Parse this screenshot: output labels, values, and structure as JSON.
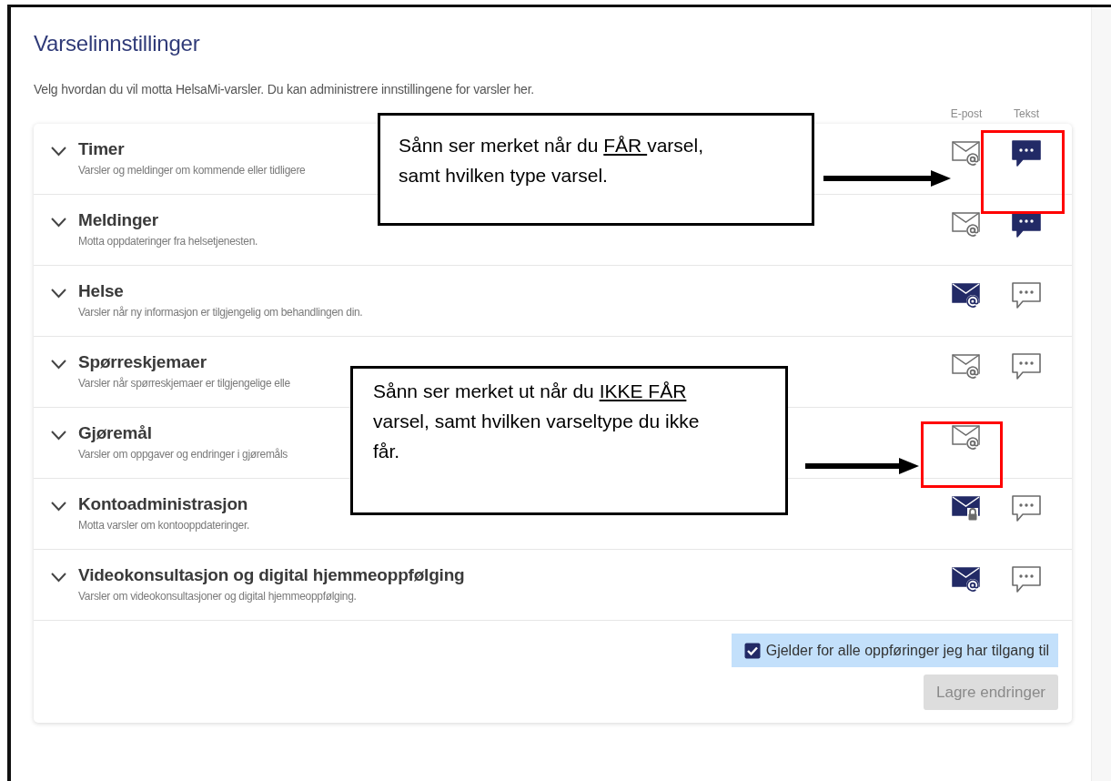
{
  "title": "Varselinnstillinger",
  "description": "Velg hvordan du vil motta HelsaMi-varsler. Du kan administrere innstillingene for varsler her.",
  "columns": [
    "E-post",
    "Tekst"
  ],
  "categories": [
    {
      "name": "Timer",
      "description": "Varsler og meldinger om kommende eller tidligere",
      "email": {
        "on": false,
        "kind": "at"
      },
      "text": {
        "on": true
      }
    },
    {
      "name": "Meldinger",
      "description": "Motta oppdateringer fra helsetjenesten.",
      "email": {
        "on": false,
        "kind": "at"
      },
      "text": {
        "on": true
      }
    },
    {
      "name": "Helse",
      "description": "Varsler når ny informasjon er tilgjengelig om behandlingen din.",
      "email": {
        "on": true,
        "kind": "at"
      },
      "text": {
        "on": false
      }
    },
    {
      "name": "Spørreskjemaer",
      "description": "Varsler når spørreskjemaer er tilgjengelige elle",
      "email": {
        "on": false,
        "kind": "at"
      },
      "text": {
        "on": false
      }
    },
    {
      "name": "Gjøremål",
      "description": "Varsler om oppgaver og endringer i gjøremåls",
      "email": {
        "on": false,
        "kind": "at"
      }
    },
    {
      "name": "Kontoadministrasjon",
      "description": "Motta varsler om kontooppdateringer.",
      "email": {
        "on": true,
        "kind": "lock"
      },
      "text": {
        "on": false
      }
    },
    {
      "name": "Videokonsultasjon og digital hjemmeoppfølging",
      "description": "Varsler om videokonsultasjoner og digital hjemmeoppfølging.",
      "email": {
        "on": true,
        "kind": "at"
      },
      "text": {
        "on": false
      }
    }
  ],
  "apply_all": {
    "label": "Gjelder for alle oppføringer jeg har tilgang til",
    "checked": true
  },
  "save_button": {
    "label": "Lagre endringer",
    "disabled": true
  },
  "annotations": [
    {
      "parts": [
        {
          "text": "Sånn ser merket når du "
        },
        {
          "text": "FÅR ",
          "underline": true
        },
        {
          "text": "varsel, samt hvilken type varsel."
        }
      ]
    },
    {
      "parts": [
        {
          "text": "Sånn ser merket ut når du "
        },
        {
          "text": "IKKE FÅR",
          "underline": true
        },
        {
          "text": " varsel, samt hvilken varseltype du ikke får."
        }
      ]
    }
  ]
}
